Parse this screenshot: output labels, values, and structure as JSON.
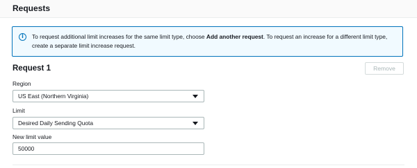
{
  "panel": {
    "title": "Requests"
  },
  "info": {
    "text_1": "To request additional limit increases for the same limit type, choose ",
    "bold": "Add another request",
    "text_2": ". To request an increase for a different limit type, create a separate limit increase request."
  },
  "request": {
    "title": "Request 1",
    "remove_label": "Remove",
    "region": {
      "label": "Region",
      "value": "US East (Northern Virginia)"
    },
    "limit": {
      "label": "Limit",
      "value": "Desired Daily Sending Quota"
    },
    "new_limit": {
      "label": "New limit value",
      "value": "50000"
    }
  },
  "icons": {
    "info": "info-icon",
    "caret": "caret-down-icon"
  },
  "colors": {
    "accent": "#0073bb",
    "info_bg": "#f1faff",
    "disabled_text": "#aab7b8"
  }
}
